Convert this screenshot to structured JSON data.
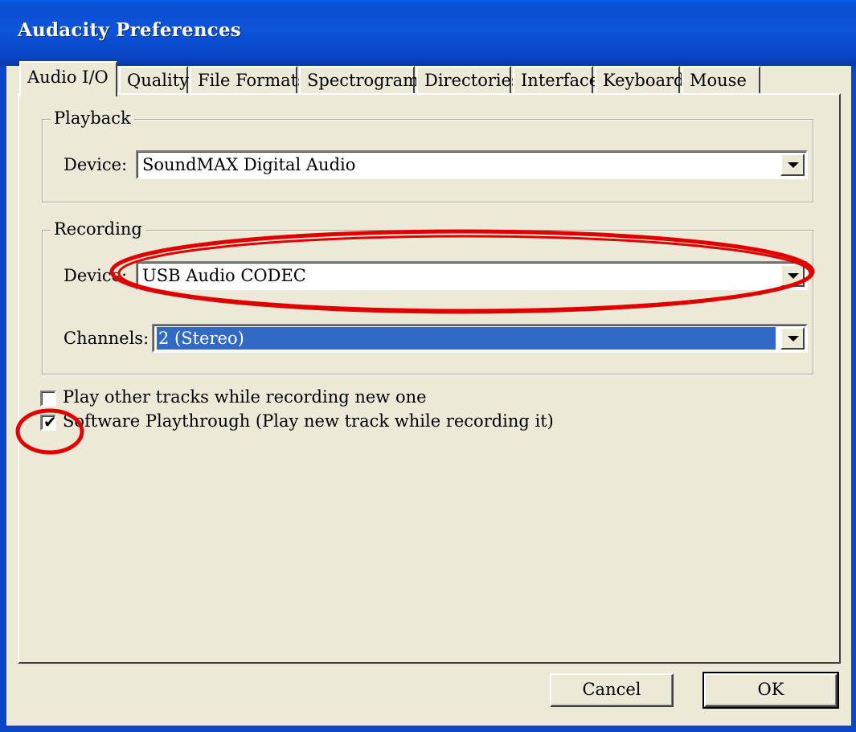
{
  "window": {
    "title": "Audacity Preferences"
  },
  "tabs": [
    {
      "label": "Audio I/O",
      "active": true
    },
    {
      "label": "Quality"
    },
    {
      "label": "File Formats"
    },
    {
      "label": "Spectrograms"
    },
    {
      "label": "Directories"
    },
    {
      "label": "Interface"
    },
    {
      "label": "Keyboard"
    },
    {
      "label": "Mouse"
    }
  ],
  "playback": {
    "legend": "Playback",
    "device_label": "Device:",
    "device_value": "SoundMAX Digital Audio"
  },
  "recording": {
    "legend": "Recording",
    "device_label": "Device:",
    "device_value": "USB Audio CODEC",
    "channels_label": "Channels:",
    "channels_value": "2 (Stereo)"
  },
  "options": {
    "play_other_tracks": {
      "label": "Play other tracks while recording new one",
      "checked": false
    },
    "software_playthrough": {
      "label": "Software Playthrough (Play new track while recording it)",
      "checked": true
    }
  },
  "buttons": {
    "cancel": "Cancel",
    "ok": "OK"
  },
  "colors": {
    "titlebar": "#0a4fd2",
    "dialog_bg": "#ece9d8",
    "selection": "#316ac5",
    "annotation": "#e00000"
  }
}
